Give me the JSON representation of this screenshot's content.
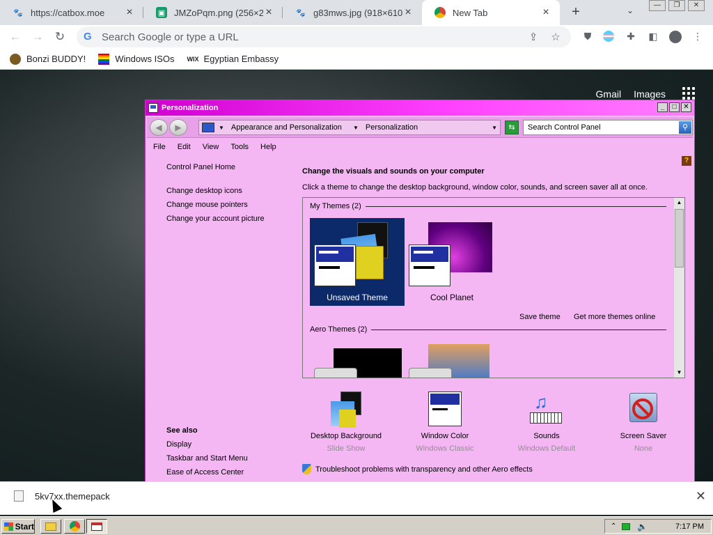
{
  "browser": {
    "tabs": [
      {
        "title": "https://catbox.moe",
        "active": false
      },
      {
        "title": "JMZoPqm.png (256×256)",
        "active": false
      },
      {
        "title": "g83mws.jpg (918×610)",
        "active": false
      },
      {
        "title": "New Tab",
        "active": true
      }
    ],
    "omnibox_placeholder": "Search Google or type a URL",
    "bookmarks": [
      "Bonzi BUDDY!",
      "Windows ISOs",
      "Egyptian Embassy"
    ],
    "google_links": [
      "Gmail",
      "Images"
    ]
  },
  "window": {
    "title": "Personalization",
    "breadcrumb": [
      "Appearance and Personalization",
      "Personalization"
    ],
    "search_placeholder": "Search Control Panel",
    "menu": [
      "File",
      "Edit",
      "View",
      "Tools",
      "Help"
    ],
    "sidebar_links": [
      "Control Panel Home",
      "Change desktop icons",
      "Change mouse pointers",
      "Change your account picture"
    ],
    "see_also": {
      "header": "See also",
      "links": [
        "Display",
        "Taskbar and Start Menu",
        "Ease of Access Center"
      ]
    },
    "main": {
      "title": "Change the visuals and sounds on your computer",
      "description": "Click a theme to change the desktop background, window color, sounds, and screen saver all at once.",
      "groups": [
        {
          "label": "My Themes (2)",
          "themes": [
            "Unsaved Theme",
            "Cool Planet"
          ]
        },
        {
          "label": "Aero Themes (2)"
        }
      ],
      "save_theme": "Save theme",
      "get_more": "Get more themes online"
    },
    "bottom": [
      {
        "label": "Desktop Background",
        "value": "Slide Show"
      },
      {
        "label": "Window Color",
        "value": "Windows Classic"
      },
      {
        "label": "Sounds",
        "value": "Windows Default"
      },
      {
        "label": "Screen Saver",
        "value": "None"
      }
    ],
    "troubleshoot": "Troubleshoot problems with transparency and other Aero effects"
  },
  "download": {
    "filename": "5kv7xx.themepack"
  },
  "taskbar": {
    "start": "Start",
    "clock": "7:17 PM"
  },
  "colors": {
    "window_bg": "#f4b7f4",
    "titlebar": "#e000e0",
    "selected_theme": "#0c2a6a"
  }
}
